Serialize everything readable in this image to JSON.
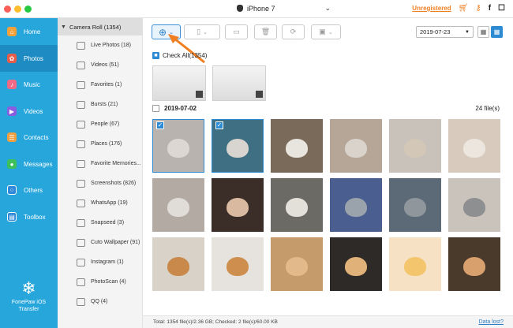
{
  "window": {
    "device_name": "iPhone 7",
    "unregistered_label": "Unregistered"
  },
  "nav": {
    "items": [
      {
        "label": "Home",
        "icon": "home-icon",
        "color": "#f3a13a"
      },
      {
        "label": "Photos",
        "icon": "photos-icon",
        "color": "#e85d4a"
      },
      {
        "label": "Music",
        "icon": "music-icon",
        "color": "#f06a85"
      },
      {
        "label": "Videos",
        "icon": "videos-icon",
        "color": "#8a5ce0"
      },
      {
        "label": "Contacts",
        "icon": "contacts-icon",
        "color": "#f0a040"
      },
      {
        "label": "Messages",
        "icon": "messages-icon",
        "color": "#3dc05a"
      },
      {
        "label": "Others",
        "icon": "others-icon",
        "color": "#2f89d8"
      },
      {
        "label": "Toolbox",
        "icon": "toolbox-icon",
        "color": "#2f89d8"
      }
    ],
    "active": "Photos",
    "brand_line1": "FonePaw iOS",
    "brand_line2": "Transfer"
  },
  "albums": {
    "header": "Camera Roll (1354)",
    "items": [
      {
        "label": "Live Photos (18)",
        "icon": "live-photos-icon"
      },
      {
        "label": "Videos (51)",
        "icon": "video-album-icon"
      },
      {
        "label": "Favorites (1)",
        "icon": "heart-icon"
      },
      {
        "label": "Bursts (21)",
        "icon": "bursts-icon"
      },
      {
        "label": "People (67)",
        "icon": "people-icon"
      },
      {
        "label": "Places (176)",
        "icon": "places-icon"
      },
      {
        "label": "Favorite Memories...",
        "icon": "heart-icon"
      },
      {
        "label": "Screenshots (826)",
        "icon": "screenshots-icon"
      },
      {
        "label": "WhatsApp (19)",
        "icon": "folder-icon"
      },
      {
        "label": "Snapseed (3)",
        "icon": "folder-icon"
      },
      {
        "label": "Cuto Wallpaper (91)",
        "icon": "folder-icon"
      },
      {
        "label": "Instagram (1)",
        "icon": "folder-icon"
      },
      {
        "label": "PhotoScan (4)",
        "icon": "folder-icon"
      },
      {
        "label": "QQ (4)",
        "icon": "folder-icon"
      }
    ]
  },
  "toolbar": {
    "date_value": "2019-07-23"
  },
  "content": {
    "check_all_label": "Check All(1354)",
    "date_group": "2019-07-02",
    "file_count": "24 file(s)",
    "photos": [
      {
        "bg": "#b9b3b0",
        "cat": "#dcd7d3",
        "selected": true
      },
      {
        "bg": "#3e6f82",
        "cat": "#d8d4cf",
        "selected": true
      },
      {
        "bg": "#7a6a5a",
        "cat": "#e8e4de",
        "selected": false
      },
      {
        "bg": "#b6a698",
        "cat": "#d9d3cc",
        "selected": false
      },
      {
        "bg": "#c8c2bb",
        "cat": "#d3c7b7",
        "selected": false
      },
      {
        "bg": "#d8cbbd",
        "cat": "#ece6de",
        "selected": false
      },
      {
        "bg": "#b2aaa3",
        "cat": "#e0dcd8",
        "selected": false
      },
      {
        "bg": "#3b2e28",
        "cat": "#d9b9a0",
        "selected": false
      },
      {
        "bg": "#6b6a65",
        "cat": "#e3dfd9",
        "selected": false
      },
      {
        "bg": "#4a5f8f",
        "cat": "#9aa3ab",
        "selected": false
      },
      {
        "bg": "#5c6a78",
        "cat": "#8f969c",
        "selected": false
      },
      {
        "bg": "#cac3bc",
        "cat": "#8d8f91",
        "selected": false
      },
      {
        "bg": "#d9d2c9",
        "cat": "#c9894a",
        "selected": false
      },
      {
        "bg": "#e6e2de",
        "cat": "#cd8e4e",
        "selected": false
      },
      {
        "bg": "#c69b6c",
        "cat": "#e2b98a",
        "selected": false
      },
      {
        "bg": "#2e2a27",
        "cat": "#e0b27a",
        "selected": false
      },
      {
        "bg": "#f6e1c4",
        "cat": "#f3c56c",
        "selected": false
      },
      {
        "bg": "#4a3a2c",
        "cat": "#d8a06c",
        "selected": false
      }
    ]
  },
  "status": {
    "summary": "Total: 1354 file(s)/2.36 GB; Checked: 2 file(s)/60.00 KB",
    "data_lost": "Data lost?"
  }
}
